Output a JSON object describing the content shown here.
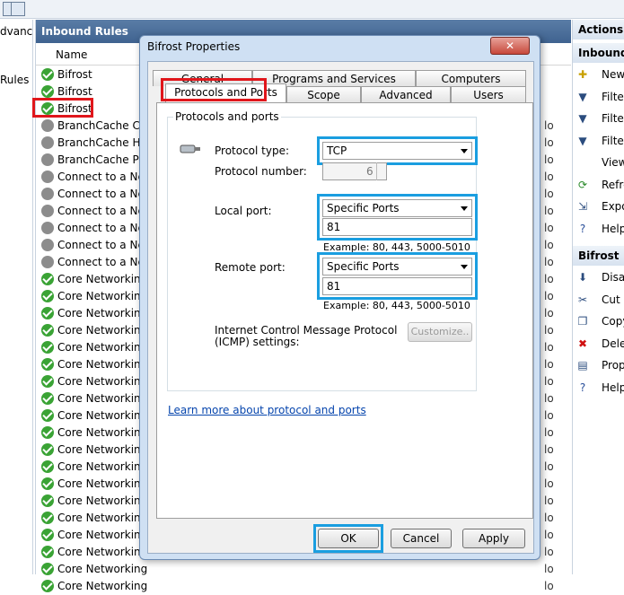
{
  "tree": {
    "items": [
      "dvance",
      "Rules"
    ]
  },
  "list": {
    "title": "Inbound Rules",
    "column": "Name",
    "rows": [
      {
        "name": "Bifrost",
        "enabled": true,
        "tail": ""
      },
      {
        "name": "Bifrost",
        "enabled": true,
        "tail": ""
      },
      {
        "name": "Bifrost",
        "enabled": true,
        "tail": ""
      },
      {
        "name": "BranchCache Con",
        "enabled": false,
        "tail": "lo"
      },
      {
        "name": "BranchCache Hos",
        "enabled": false,
        "tail": "lo"
      },
      {
        "name": "BranchCache Pee",
        "enabled": false,
        "tail": "lo"
      },
      {
        "name": "Connect to a Netw",
        "enabled": false,
        "tail": "lo"
      },
      {
        "name": "Connect to a Netw",
        "enabled": false,
        "tail": "lo"
      },
      {
        "name": "Connect to a Netw",
        "enabled": false,
        "tail": "lo"
      },
      {
        "name": "Connect to a Netw",
        "enabled": false,
        "tail": "lo"
      },
      {
        "name": "Connect to a Netw",
        "enabled": false,
        "tail": "lo"
      },
      {
        "name": "Connect to a Netw",
        "enabled": false,
        "tail": "lo"
      },
      {
        "name": "Core Networking",
        "enabled": true,
        "tail": "lo"
      },
      {
        "name": "Core Networking",
        "enabled": true,
        "tail": "lo"
      },
      {
        "name": "Core Networking",
        "enabled": true,
        "tail": "lo"
      },
      {
        "name": "Core Networking",
        "enabled": true,
        "tail": "lo"
      },
      {
        "name": "Core Networking",
        "enabled": true,
        "tail": "lo"
      },
      {
        "name": "Core Networking",
        "enabled": true,
        "tail": "lo"
      },
      {
        "name": "Core Networking",
        "enabled": true,
        "tail": "lo"
      },
      {
        "name": "Core Networking",
        "enabled": true,
        "tail": "lo"
      },
      {
        "name": "Core Networking",
        "enabled": true,
        "tail": "lo"
      },
      {
        "name": "Core Networking",
        "enabled": true,
        "tail": "lo"
      },
      {
        "name": "Core Networking",
        "enabled": true,
        "tail": "lo"
      },
      {
        "name": "Core Networking",
        "enabled": true,
        "tail": "lo"
      },
      {
        "name": "Core Networking",
        "enabled": true,
        "tail": "lo"
      },
      {
        "name": "Core Networking",
        "enabled": true,
        "tail": "lo"
      },
      {
        "name": "Core Networking",
        "enabled": true,
        "tail": "lo"
      },
      {
        "name": "Core Networking",
        "enabled": true,
        "tail": "lo"
      },
      {
        "name": "Core Networking",
        "enabled": true,
        "tail": "lo"
      },
      {
        "name": "Core Networking",
        "enabled": true,
        "tail": "lo"
      },
      {
        "name": "Core Networking",
        "enabled": true,
        "tail": "lo"
      }
    ]
  },
  "actions": {
    "title": "Actions",
    "section1": "Inbound R",
    "items1": [
      {
        "label": "New",
        "icon": "new-rule-icon"
      },
      {
        "label": "Filter",
        "icon": "filter-icon"
      },
      {
        "label": "Filter",
        "icon": "filter-icon"
      },
      {
        "label": "Filter",
        "icon": "filter-icon"
      },
      {
        "label": "View",
        "icon": ""
      },
      {
        "label": "Refre",
        "icon": "refresh-icon"
      },
      {
        "label": "Expo",
        "icon": "export-icon"
      },
      {
        "label": "Help",
        "icon": "help-icon"
      }
    ],
    "section2": "Bifrost",
    "items2": [
      {
        "label": "Disab",
        "icon": "disable-icon"
      },
      {
        "label": "Cut",
        "icon": "cut-icon"
      },
      {
        "label": "Copy",
        "icon": "copy-icon"
      },
      {
        "label": "Delet",
        "icon": "delete-icon"
      },
      {
        "label": "Prop",
        "icon": "properties-icon"
      },
      {
        "label": "Help",
        "icon": "help-icon"
      }
    ]
  },
  "dialog": {
    "title": "Bifrost Properties",
    "close": "✕",
    "tabs_row1": [
      "General",
      "Programs and Services",
      "Computers"
    ],
    "tabs_row2": [
      "Protocols and Ports",
      "Scope",
      "Advanced",
      "Users"
    ],
    "group_title": "Protocols and ports",
    "protocol_type_label": "Protocol type:",
    "protocol_type_value": "TCP",
    "protocol_number_label": "Protocol number:",
    "protocol_number_value": "6",
    "local_port_label": "Local port:",
    "local_port_mode": "Specific Ports",
    "local_port_value": "81",
    "local_port_example": "Example: 80, 443, 5000-5010",
    "remote_port_label": "Remote port:",
    "remote_port_mode": "Specific Ports",
    "remote_port_value": "81",
    "remote_port_example": "Example: 80, 443, 5000-5010",
    "icmp_label_line1": "Internet Control Message Protocol",
    "icmp_label_line2": "(ICMP) settings:",
    "customize": "Customize..",
    "learn_more": "Learn more about protocol and ports",
    "ok": "OK",
    "cancel": "Cancel",
    "apply": "Apply"
  },
  "colors": {
    "highlight_red": "#e0161b",
    "highlight_blue": "#1a9ee0",
    "enabled_green": "#3aa335"
  }
}
